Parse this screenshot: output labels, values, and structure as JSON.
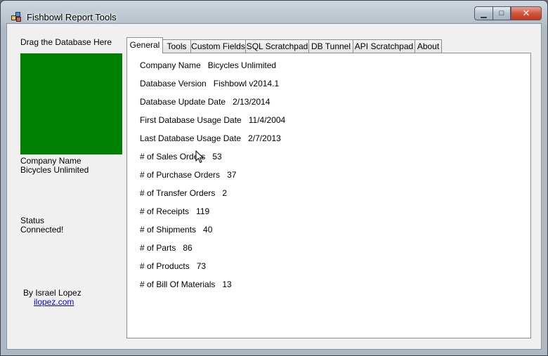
{
  "window": {
    "title": "Fishbowl Report Tools"
  },
  "left": {
    "drop_label": "Drag the Database Here",
    "company_label": "Company Name",
    "company_value": "Bicycles Unlimited",
    "status_label": "Status",
    "status_value": "Connected!",
    "author": "By Israel Lopez",
    "link": "ilopez.com",
    "drop_color": "#008000"
  },
  "tabs": [
    "General",
    "Tools",
    "Custom Fields",
    "SQL Scratchpad",
    "DB Tunnel",
    "API Scratchpad",
    "About"
  ],
  "general": {
    "rows": [
      {
        "label": "Company Name",
        "value": "Bicycles Unlimited"
      },
      {
        "label": "Database Version",
        "value": "Fishbowl v2014.1"
      },
      {
        "label": "Database Update Date",
        "value": "2/13/2014"
      },
      {
        "label": "First Database Usage Date",
        "value": "11/4/2004"
      },
      {
        "label": "Last Database Usage Date",
        "value": "2/7/2013"
      },
      {
        "label": "# of Sales Orders",
        "value": "53"
      },
      {
        "label": "# of Purchase Orders",
        "value": "37"
      },
      {
        "label": "# of Transfer Orders",
        "value": "2"
      },
      {
        "label": "# of Receipts",
        "value": "119"
      },
      {
        "label": "# of Shipments",
        "value": "40"
      },
      {
        "label": "# of Parts",
        "value": "86"
      },
      {
        "label": "# of Products",
        "value": "73"
      },
      {
        "label": "# of Bill Of Materials",
        "value": "13"
      }
    ]
  }
}
